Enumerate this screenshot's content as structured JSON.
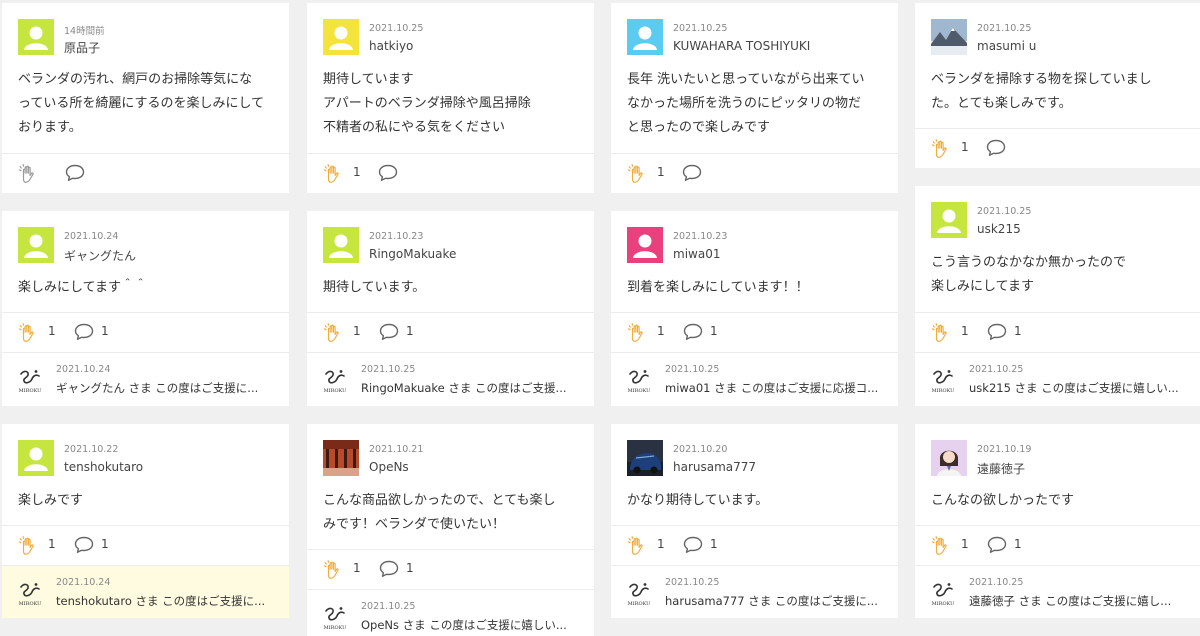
{
  "colors": {
    "green": "#c6e63f",
    "yellow": "#f4e23d",
    "blue": "#5ccbf0",
    "pink": "#e8417d",
    "lavender": "#e6d2ee",
    "clap": "#f0ad3e",
    "highlight": "#fffbe0"
  },
  "reply_logo_text": "MIROKU",
  "cards": [
    {
      "date": "14時間前",
      "name": "原品子",
      "body": [
        "ベランダの汚れ、網戸のお掃除等気にな",
        "っている所を綺麗にするのを楽しみにして",
        "おります。"
      ],
      "claps": "",
      "comments": ""
    },
    {
      "date": "2021.10.25",
      "name": "hatkiyo",
      "body": [
        "期待しています",
        "アパートのベランダ掃除や風呂掃除",
        "不精者の私にやる気をください"
      ],
      "claps": "1",
      "comments": ""
    },
    {
      "date": "2021.10.25",
      "name": "KUWAHARA TOSHIYUKI",
      "body": [
        "長年 洗いたいと思っていながら出来てい",
        "なかった場所を洗うのにピッタリの物だ",
        "と思ったので楽しみです"
      ],
      "claps": "1",
      "comments": ""
    },
    {
      "date": "2021.10.25",
      "name": "masumi u",
      "body": [
        "ベランダを掃除する物を探していまし",
        "た。とても楽しみです。"
      ],
      "claps": "1",
      "comments": ""
    },
    {
      "date": "2021.10.24",
      "name": "ギャングたん",
      "body": [
        "楽しみにしてます＾＾"
      ],
      "claps": "1",
      "comments": "1",
      "reply_date": "2021.10.24",
      "reply_text": "ギャングたん さま この度はご支援に..."
    },
    {
      "date": "2021.10.23",
      "name": "RingoMakuake",
      "body": [
        "期待しています。"
      ],
      "claps": "1",
      "comments": "1",
      "reply_date": "2021.10.25",
      "reply_text": "RingoMakuake さま この度はご支援..."
    },
    {
      "date": "2021.10.23",
      "name": "miwa01",
      "body": [
        "到着を楽しみにしています！！"
      ],
      "claps": "1",
      "comments": "1",
      "reply_date": "2021.10.25",
      "reply_text": "miwa01 さま この度はご支援に応援コ..."
    },
    {
      "date": "2021.10.25",
      "name": "usk215",
      "body": [
        "こう言うのなかなか無かったので",
        "楽しみにしてます"
      ],
      "claps": "1",
      "comments": "1",
      "reply_date": "2021.10.25",
      "reply_text": "usk215 さま この度はご支援に嬉しい..."
    },
    {
      "date": "2021.10.22",
      "name": "tenshokutaro",
      "body": [
        "楽しみです"
      ],
      "claps": "1",
      "comments": "1",
      "reply_date": "2021.10.24",
      "reply_text": "tenshokutaro さま この度はご支援に..."
    },
    {
      "date": "2021.10.21",
      "name": "OpeNs",
      "body": [
        "こんな商品欲しかったので、とても楽し",
        "みです！ベランダで使いたい！"
      ],
      "claps": "1",
      "comments": "1",
      "reply_date": "2021.10.25",
      "reply_text": "OpeNs さま この度はご支援に嬉しい..."
    },
    {
      "date": "2021.10.20",
      "name": "harusama777",
      "body": [
        "かなり期待しています。"
      ],
      "claps": "1",
      "comments": "1",
      "reply_date": "2021.10.25",
      "reply_text": "harusama777 さま この度はご支援に..."
    },
    {
      "date": "2021.10.19",
      "name": "遠藤徳子",
      "body": [
        "こんなの欲しかったです"
      ],
      "claps": "1",
      "comments": "1",
      "reply_date": "2021.10.25",
      "reply_text": "遠藤徳子 さま この度はご支援に嬉し..."
    }
  ]
}
